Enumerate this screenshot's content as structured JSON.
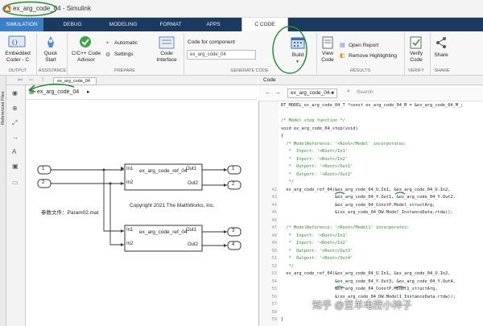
{
  "window": {
    "title": "ex_arg_code_04 - Simulink"
  },
  "tabs": [
    "SIMULATION",
    "DEBUG",
    "MODELING",
    "FORMAT",
    "APPS",
    "C CODE"
  ],
  "ribbon": {
    "embedded_coder": "Embedded\nCoder - C",
    "quick_start": "Quick\nStart",
    "cpp_advisor": "C/C++ Code\nAdvisor",
    "automatic": "Automatic",
    "settings": "Settings",
    "code_for_component_label": "Code for component",
    "code_for_component_value": "ex_arg_code_04",
    "code_interface": "Code\nInterface",
    "build": "Build",
    "view_code": "View\nCode",
    "open_report": "Open Report",
    "remove_highlighting": "Remove Highlighting",
    "verify_code": "Verify\nCode",
    "share": "Share",
    "sections": {
      "output": "OUTPUT",
      "assistance": "ASSISTANCE",
      "prepare": "PREPARE",
      "generate_code": "GENERATE CODE",
      "results": "RESULTS",
      "verify": "VERIFY",
      "share": "SHARE"
    }
  },
  "left_strip": {
    "label": "Referenced Files"
  },
  "model": {
    "tab": "ex_arg_code_04",
    "breadcrumb": "ex_arg_code_04",
    "inports": [
      "1",
      "2"
    ],
    "outports": [
      "1",
      "2",
      "3",
      "4"
    ],
    "blocks": [
      {
        "name": "ex_arg_code_ref_04",
        "in1": "In1",
        "in2": "In2",
        "out1": "Out1",
        "out2": "Out2"
      },
      {
        "name": "ex_arg_code_ref_04",
        "in1": "In1",
        "in2": "In2",
        "out1": "Out1",
        "out2": "Out2"
      }
    ],
    "param_note": "参数文件：Param02.mat",
    "copyright": "Copyright 2021 The MathWorks, Inc."
  },
  "code": {
    "panel_title": "Code",
    "file": "ex_arg_code_04.c",
    "search_placeholder": "Search",
    "lines": [
      {
        "n": "",
        "t": "RT_MODEL_ex_arg_code_04_T *const ex_arg_code_04_M = &ex_arg_code_04_M_;",
        "c": ""
      },
      {
        "n": "",
        "t": "",
        "c": ""
      },
      {
        "n": "",
        "t": "/* Model step function */",
        "c": "cm"
      },
      {
        "n": "",
        "t": "void ex_arg_code_04_step(void)",
        "c": ""
      },
      {
        "n": "",
        "t": "{",
        "c": ""
      },
      {
        "n": "",
        "t": "  /* ModelReference: '<Root>/Model' incorporates:",
        "c": "cm"
      },
      {
        "n": "",
        "t": "   *  Inport: '<Root>/In1'",
        "c": "cm"
      },
      {
        "n": "",
        "t": "   *  Inport: '<Root>/In2'",
        "c": "cm"
      },
      {
        "n": "",
        "t": "   *  Outport: '<Root>/Out1'",
        "c": "cm"
      },
      {
        "n": "",
        "t": "   *  Outport: '<Root>/Out2'",
        "c": "cm"
      },
      {
        "n": "",
        "t": "   */",
        "c": "cm"
      },
      {
        "n": "42",
        "t": "  ex_arg_code_ref_04(&ex_arg_code_04_U.In1, &ex_arg_code_04_U.In2,",
        "c": ""
      },
      {
        "n": "43",
        "t": "                     &ex_arg_code_04_Y.Out1, &ex_arg_code_04_Y.Out2,",
        "c": ""
      },
      {
        "n": "44",
        "t": "                     &ex_arg_code_04_ConstP.Model_structArg,",
        "c": ""
      },
      {
        "n": "45",
        "t": "                     &(ex_arg_code_04_DW.Model_InstanceData.rtdw));",
        "c": ""
      },
      {
        "n": "46",
        "t": "",
        "c": ""
      },
      {
        "n": "47",
        "t": "  /* ModelReference: '<Root>/Model1' incorporates:",
        "c": "cm"
      },
      {
        "n": "48",
        "t": "   *  Inport: '<Root>/In1'",
        "c": "cm"
      },
      {
        "n": "49",
        "t": "   *  Inport: '<Root>/In2'",
        "c": "cm"
      },
      {
        "n": "50",
        "t": "   *  Outport: '<Root>/Out3'",
        "c": "cm"
      },
      {
        "n": "51",
        "t": "   *  Outport: '<Root>/Out4'",
        "c": "cm"
      },
      {
        "n": "52",
        "t": "   */",
        "c": "cm"
      },
      {
        "n": "53",
        "t": "  ex_arg_code_ref_04(&ex_arg_code_04_U.In1, &ex_arg_code_04_U.In2,",
        "c": ""
      },
      {
        "n": "54",
        "t": "                     &ex_arg_code_04_Y.Out3, &ex_arg_code_04_Y.Out4,",
        "c": ""
      },
      {
        "n": "55",
        "t": "                     &ex_arg_code_04_ConstP.Model1_structArg,",
        "c": ""
      },
      {
        "n": "56",
        "t": "                     &(ex_arg_code_04_DW.Model1_InstanceData.rtdw));",
        "c": ""
      },
      {
        "n": "57",
        "t": "",
        "c": ""
      },
      {
        "n": "58",
        "t": "",
        "c": ""
      },
      {
        "n": "59",
        "t": "}",
        "c": ""
      }
    ]
  },
  "watermark": "知乎 @豆羊电控小神子",
  "colors": {
    "tab_bar": "#1a3a5f",
    "active_tab": "#3a7fc8",
    "annotation": "#1f8f2f"
  }
}
